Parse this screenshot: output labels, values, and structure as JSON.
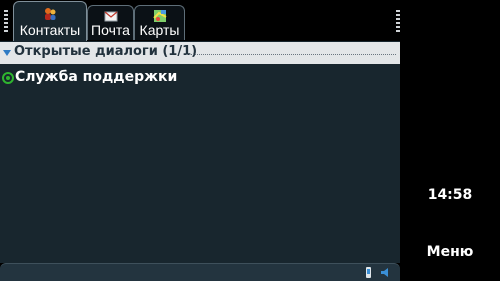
{
  "tabs": [
    {
      "id": "contacts",
      "label": "Контакты",
      "icon": "contacts-icon",
      "active": true
    },
    {
      "id": "mail",
      "label": "Почта",
      "icon": "mail-icon",
      "active": false
    },
    {
      "id": "maps",
      "label": "Карты",
      "icon": "maps-icon",
      "active": false
    }
  ],
  "group": {
    "label": "Открытые диалоги (1/1)",
    "collapse_icon": "triangle-down-icon"
  },
  "contacts": [
    {
      "name": "Служба поддержки",
      "status": "online",
      "status_color": "#2fb52f"
    }
  ],
  "side": {
    "time": "14:58",
    "softkey_label": "Меню"
  },
  "status_icons": [
    "phone-icon",
    "speaker-icon"
  ],
  "colors": {
    "content_bg": "#18262e",
    "header_bg": "#e3e6e8",
    "accent": "#2e7bc4"
  }
}
